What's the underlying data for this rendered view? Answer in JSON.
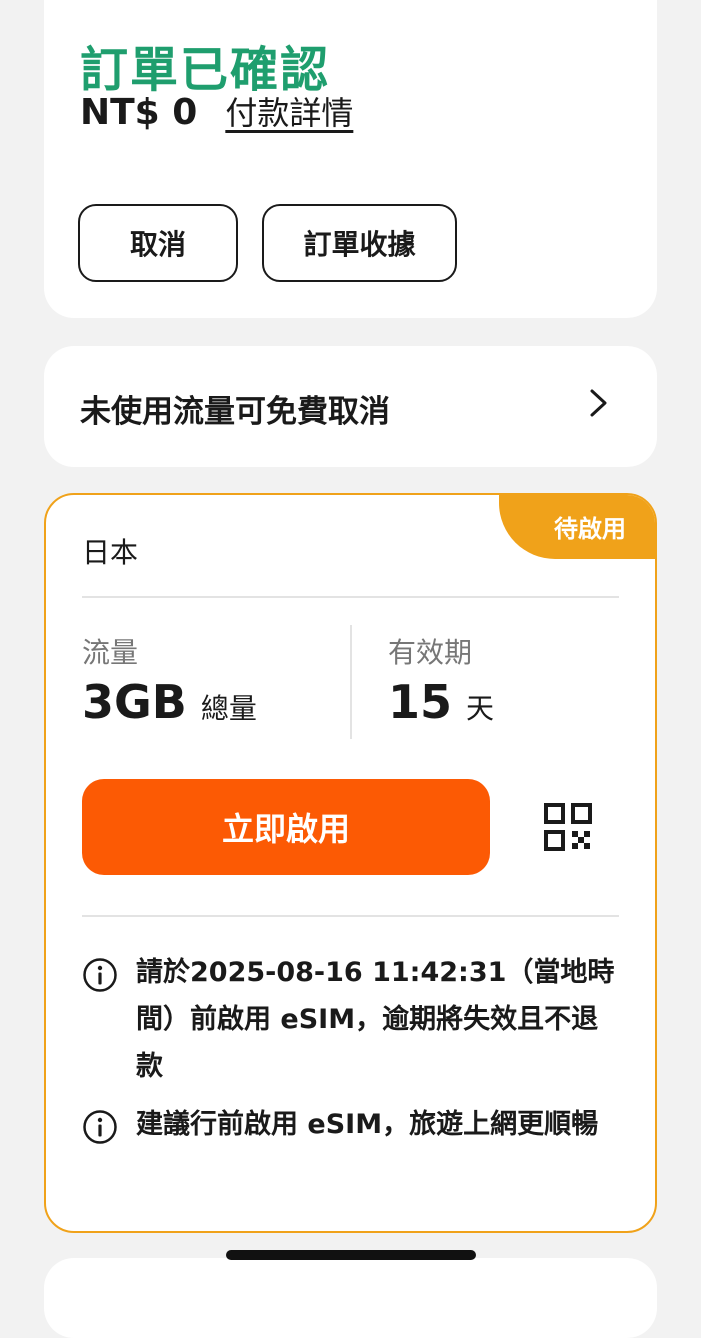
{
  "order": {
    "title": "訂單已確認",
    "price": "NT$ 0",
    "payment_details_link": "付款詳情",
    "cancel_button": "取消",
    "receipt_button": "訂單收據"
  },
  "free_cancel": {
    "text": "未使用流量可免費取消",
    "icon": "chevron-right-icon"
  },
  "esim": {
    "status_badge": "待啟用",
    "country": "日本",
    "data_label": "流量",
    "data_value": "3GB",
    "data_unit": "總量",
    "validity_label": "有效期",
    "validity_value": "15",
    "validity_unit": "天",
    "activate_button": "立即啟用",
    "qr_icon": "qr-code-icon",
    "notices": [
      "請於2025-08-16 11:42:31（當地時間）前啟用 eSIM，逾期將失效且不退款",
      "建議行前啟用 eSIM，旅遊上網更順暢"
    ]
  },
  "colors": {
    "title_green": "#1f9e6e",
    "accent_orange": "#fc5a04",
    "badge_amber": "#f0a21a",
    "background": "#f2f2f2"
  }
}
